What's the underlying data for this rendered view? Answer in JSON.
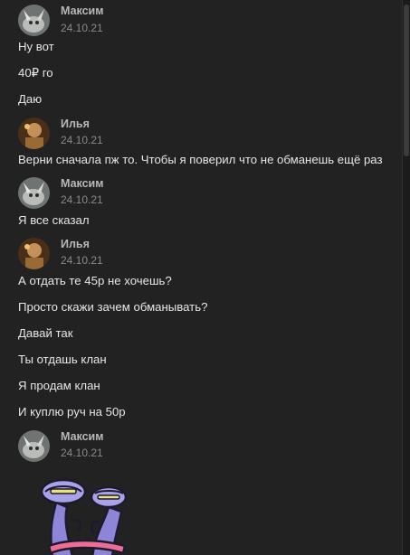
{
  "chat": {
    "groups": [
      {
        "author": "Максим",
        "date": "24.10.21",
        "avatar": "avatar-maxim",
        "messages": [
          "Ну вот",
          "40₽ го",
          "Даю"
        ]
      },
      {
        "author": "Илья",
        "date": "24.10.21",
        "avatar": "avatar-ilya",
        "messages": [
          "Верни сначала пж то. Чтобы я поверил что не обманешь ещё раз"
        ]
      },
      {
        "author": "Максим",
        "date": "24.10.21",
        "avatar": "avatar-maxim",
        "messages": [
          "Я все сказал"
        ]
      },
      {
        "author": "Илья",
        "date": "24.10.21",
        "avatar": "avatar-ilya",
        "messages": [
          "А отдать те 45р не хочешь?",
          "Просто скажи зачем обманывать?",
          "Давай так",
          "Ты отдашь клан",
          "Я продам клан",
          "И куплю руч на 50р"
        ]
      },
      {
        "author": "Максим",
        "date": "24.10.21",
        "avatar": "avatar-maxim",
        "messages": [],
        "sticker": "purple-creature-sticker"
      }
    ]
  },
  "colors": {
    "background": "#222222",
    "name": "#b8b8b8",
    "date": "#8a8a8a",
    "text": "#e6e6e6"
  }
}
